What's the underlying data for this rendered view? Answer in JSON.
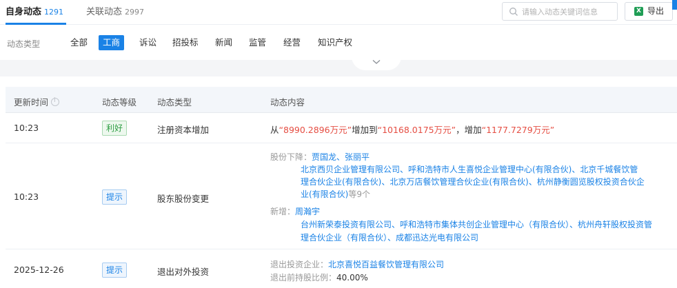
{
  "tabs": [
    {
      "label": "自身动态",
      "count": "1291"
    },
    {
      "label": "关联动态",
      "count": "2997"
    }
  ],
  "search": {
    "placeholder": "请输入动态关键词信息"
  },
  "export": {
    "icon_text": "X",
    "label": "导出"
  },
  "filters": {
    "label": "动态类型",
    "chips": [
      "全部",
      "工商",
      "诉讼",
      "招投标",
      "新闻",
      "监管",
      "经营",
      "知识产权"
    ],
    "active": "工商"
  },
  "table": {
    "headers": {
      "time": "更新时间",
      "level": "动态等级",
      "type": "动态类型",
      "content": "动态内容"
    },
    "rows": [
      {
        "time": "10:23",
        "level": "利好",
        "type": "注册资本增加",
        "content": {
          "p1": "从",
          "v1": "“8990.2896万元”",
          "p2": "增加到",
          "v2": "“10168.0175万元”",
          "p3": "，增加",
          "v3": "“1177.7279万元”"
        }
      },
      {
        "time": "10:23",
        "level": "提示",
        "type": "股东股份变更",
        "content": {
          "down_label": "股份下降：",
          "down_people": "贾国龙、张丽平",
          "down_lines": [
            "北京西贝企业管理有限公司、呼和浩特市人生喜悦企业管理中心(有限合伙)、北京千城餐饮管",
            "理合伙企业(有限合伙)、北京万店餐饮管理合伙企业(有限合伙)、杭州静衡圆览股权投资合伙企",
            "业(有限合伙)"
          ],
          "down_more": "等9个",
          "new_label": "新增：",
          "new_people": "周瀚宇",
          "new_lines": [
            "台州新荣泰投资有限公司、呼和浩特市集体共创企业管理中心（有限合伙）、杭州舟轩股权投资管",
            "理合伙企业（有限合伙）、成都迅达光电有限公司"
          ]
        }
      },
      {
        "time": "2025-12-26",
        "level": "提示",
        "type": "退出对外投资",
        "content": {
          "exit_label": "退出投资企业：",
          "exit_company": "北京喜悦百益餐饮管理有限公司",
          "ratio_label": "退出前持股比例：",
          "ratio_value": "40.00%"
        }
      }
    ]
  }
}
